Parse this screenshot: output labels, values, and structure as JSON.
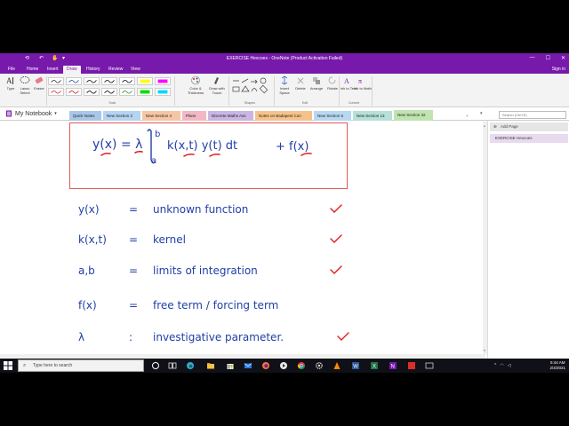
{
  "window": {
    "title": "EXERCISE Hexcoes - OneNote (Product Activation Failed)",
    "controls": [
      "—",
      "☐",
      "✕"
    ]
  },
  "menu": {
    "tabs": [
      "File",
      "Home",
      "Insert",
      "Draw",
      "History",
      "Review",
      "View"
    ],
    "active": "Draw",
    "sign_in": "Sign in"
  },
  "ribbon": {
    "tools": [
      {
        "label": "Type",
        "icon": "type-icon"
      },
      {
        "label": "Lasso Select",
        "icon": "lasso-icon"
      },
      {
        "label": "Eraser",
        "icon": "eraser-icon"
      }
    ],
    "color_thickness": "Color & Thickness",
    "draw_with_touch": "Draw with Touch",
    "insert_space": "Insert Space",
    "delete": "Delete",
    "arrange": "Arrange",
    "rotate": "Rotate",
    "ink_to_text": "Ink to Text",
    "ink_to_math": "Ink to Math",
    "groups": [
      "Tools",
      "Shapes",
      "Edit",
      "Convert"
    ],
    "highlighter_colors": [
      "#ffff00",
      "#00e000",
      "#ff00ff",
      "#00d8ff"
    ]
  },
  "notebook": {
    "name": "My Notebook",
    "sections": [
      {
        "label": "Quick Notes",
        "color": "#a9c7e8"
      },
      {
        "label": "New Section 2",
        "color": "#b4d4f0"
      },
      {
        "label": "New Section 4",
        "color": "#f6c6a4"
      },
      {
        "label": "Plans",
        "color": "#f2b8c4"
      },
      {
        "label": "Discrete Maths Ass",
        "color": "#c9b6e4"
      },
      {
        "label": "Notes on Badapest Con",
        "color": "#f5c38a"
      },
      {
        "label": "New Section 5",
        "color": "#b8d8f2"
      },
      {
        "label": "New Section 13",
        "color": "#b6e0d8"
      },
      {
        "label": "New Section 32",
        "color": "#c0e4b0"
      }
    ],
    "active_section": "New Section 32",
    "add_section": "+",
    "search_placeholder": "Search (Ctrl+E)"
  },
  "pages": {
    "add_page": "Add Page",
    "items": [
      "EXERCISE Hexcoes"
    ]
  },
  "note": {
    "formula": {
      "lhs": "y(x) = λ",
      "upper_limit": "b",
      "lower_limit": "a",
      "integrand": "k(x,t) y(t) dt",
      "plus_term": "+  f(x)"
    },
    "definitions": [
      {
        "term": "y(x)",
        "eq": "=",
        "meaning": "unknown function",
        "checked": true
      },
      {
        "term": "k(x,t)",
        "eq": "=",
        "meaning": "kernel",
        "checked": true
      },
      {
        "term": "a,b",
        "eq": "=",
        "meaning": "limits of integration",
        "checked": true
      },
      {
        "term": "f(x)",
        "eq": "=",
        "meaning": "free term / forcing term",
        "checked": false
      },
      {
        "term": "λ",
        "eq": ":",
        "meaning": "investigative parameter.",
        "checked": true
      }
    ],
    "ink_blue": "#1f3fa8",
    "ink_red": "#e02020"
  },
  "taskbar": {
    "search_placeholder": "Type here to search",
    "time": "5:44 AM",
    "date": "2/4/2021"
  }
}
